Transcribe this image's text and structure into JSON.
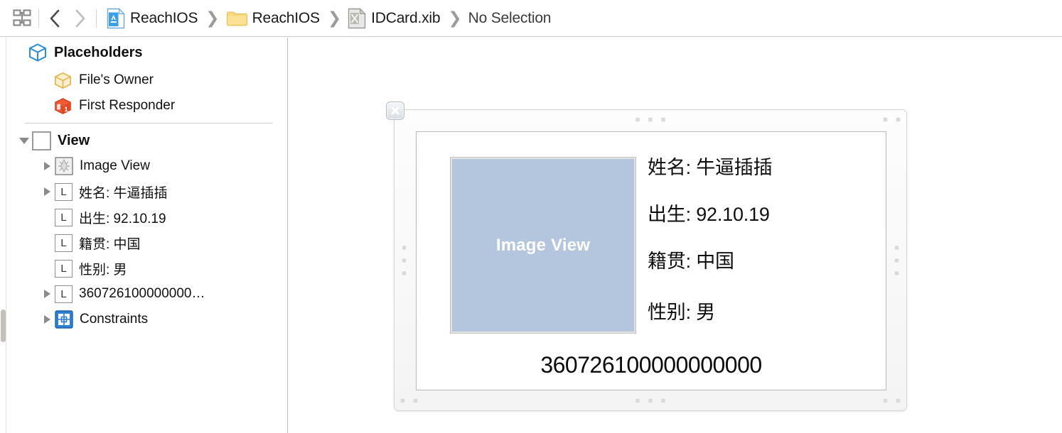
{
  "toolbar": {
    "grid_icon": "grid-layout-icon",
    "back_label": "Back",
    "forward_label": "Forward",
    "breadcrumbs": [
      {
        "icon": "xcode-project-icon",
        "label": "ReachIOS"
      },
      {
        "icon": "folder-icon",
        "label": "ReachIOS"
      },
      {
        "icon": "xib-file-icon",
        "label": "IDCard.xib"
      },
      {
        "icon": "none",
        "label": "No Selection"
      }
    ]
  },
  "sidebar": {
    "placeholders": {
      "title": "Placeholders",
      "icon": "cube-outline-icon",
      "items": [
        {
          "label": "File's Owner",
          "icon": "files-owner-cube-icon"
        },
        {
          "label": "First Responder",
          "icon": "first-responder-cube-icon"
        }
      ]
    },
    "view": {
      "label": "View",
      "icon": "view-square-icon",
      "expanded": true,
      "children": [
        {
          "label": "Image View",
          "icon": "image-view-icon",
          "has_twisty": true,
          "type": "image"
        },
        {
          "label": "姓名: 牛逼插插",
          "icon": "label-icon",
          "has_twisty": true,
          "type": "label"
        },
        {
          "label": "出生: 92.10.19",
          "icon": "label-icon",
          "has_twisty": false,
          "type": "label"
        },
        {
          "label": "籍贯: 中国",
          "icon": "label-icon",
          "has_twisty": false,
          "type": "label"
        },
        {
          "label": "性别: 男",
          "icon": "label-icon",
          "has_twisty": false,
          "type": "label"
        },
        {
          "label": "360726100000000…",
          "icon": "label-icon",
          "has_twisty": true,
          "type": "label"
        }
      ]
    },
    "constraints": {
      "label": "Constraints",
      "icon": "constraints-icon",
      "has_twisty": true
    }
  },
  "canvas": {
    "close_button_label": "×",
    "image_view": {
      "placeholder_text": "Image View",
      "fill_color": "#b3c6de"
    },
    "fields": [
      "姓名: 牛逼插插",
      "出生: 92.10.19",
      "籍贯: 中国",
      "性别: 男"
    ],
    "id_number": "360726100000000000"
  },
  "colors": {
    "accent_blue": "#1a8cd8",
    "image_placeholder": "#b3c6de",
    "divider": "#d0d0d0",
    "canvas_bg": "#ffffff"
  }
}
